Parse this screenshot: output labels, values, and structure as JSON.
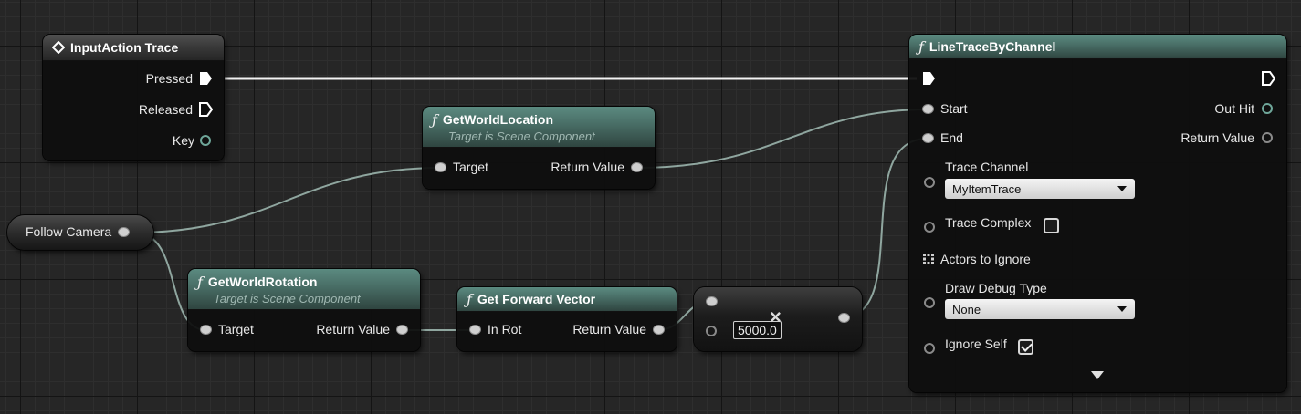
{
  "nodes": {
    "input_action": {
      "title": "InputAction Trace",
      "pins": {
        "pressed": "Pressed",
        "released": "Released",
        "key": "Key"
      }
    },
    "get_world_location": {
      "title": "GetWorldLocation",
      "subtitle": "Target is Scene Component",
      "pins": {
        "target": "Target",
        "return_value": "Return Value"
      }
    },
    "follow_camera": {
      "title": "Follow Camera"
    },
    "get_world_rotation": {
      "title": "GetWorldRotation",
      "subtitle": "Target is Scene Component",
      "pins": {
        "target": "Target",
        "return_value": "Return Value"
      }
    },
    "get_forward_vector": {
      "title": "Get Forward Vector",
      "pins": {
        "in_rot": "In Rot",
        "return_value": "Return Value"
      }
    },
    "multiply": {
      "operator": "×",
      "value": "5000.0"
    },
    "line_trace": {
      "title": "LineTraceByChannel",
      "pins": {
        "start": "Start",
        "end": "End",
        "out_hit": "Out Hit",
        "return_value": "Return Value",
        "trace_channel": "Trace Channel",
        "trace_complex": "Trace Complex",
        "actors_to_ignore": "Actors to Ignore",
        "draw_debug_type": "Draw Debug Type",
        "ignore_self": "Ignore Self"
      },
      "trace_channel_value": "MyItemTrace",
      "draw_debug_value": "None",
      "trace_complex_checked": false,
      "ignore_self_checked": true
    }
  },
  "icons": {
    "function": "ƒ",
    "event": "diamond-icon",
    "expand": "expand-arrow-icon"
  },
  "colors": {
    "function_header": "#4a7068",
    "event_header": "#3a3a3a",
    "wire": "#9fb5ad",
    "exec_wire": "#ffffff"
  }
}
